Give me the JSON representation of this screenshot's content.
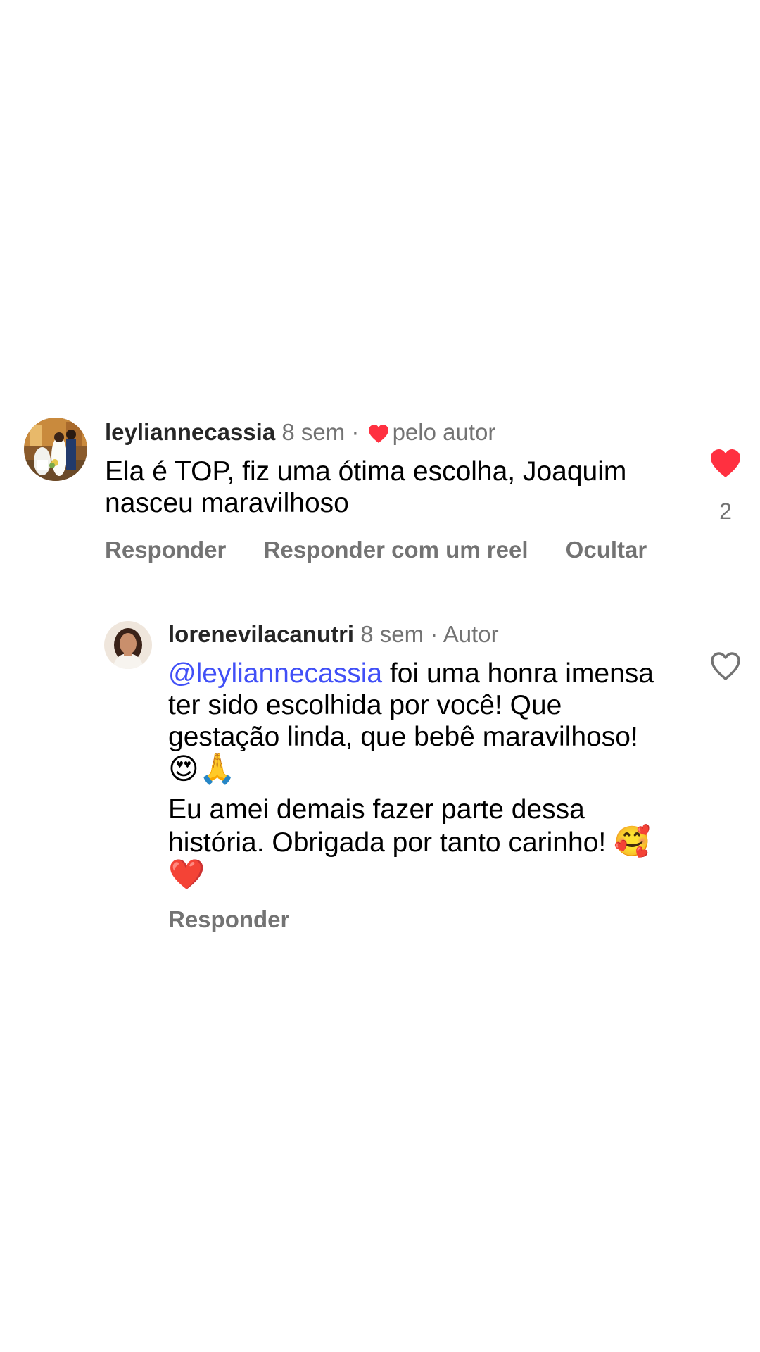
{
  "comment": {
    "username": "leyliannecassia",
    "time": "8 sem",
    "separator": "·",
    "liked_by_author_label": "pelo autor",
    "text": "Ela é TOP, fiz uma ótima escolha, Joaquim nasceu maravilhoso",
    "like_count": "2",
    "liked": true,
    "actions": {
      "reply": "Responder",
      "reply_with_reel": "Responder com um reel",
      "hide": "Ocultar"
    }
  },
  "reply": {
    "username": "lorenevilacanutri",
    "time": "8 sem",
    "separator": "·",
    "author_badge": "Autor",
    "mention": "@leyliannecassia",
    "text_after_mention": " foi uma honra imensa ter sido escolhida por você! Que gestação linda, que bebê maravilhoso! ",
    "emojis_line1": "😍🙏",
    "paragraph2": "Eu amei demais fazer parte dessa história. Obrigada por tanto carinho! ",
    "emojis_line2": "🥰❤️",
    "liked": false,
    "actions": {
      "reply": "Responder"
    }
  },
  "colors": {
    "heart_red": "#ff3040",
    "mention_blue": "#4150f7",
    "secondary_text": "#737373"
  },
  "icons": {
    "liked": "heart-filled-icon",
    "unliked": "heart-outline-icon"
  }
}
